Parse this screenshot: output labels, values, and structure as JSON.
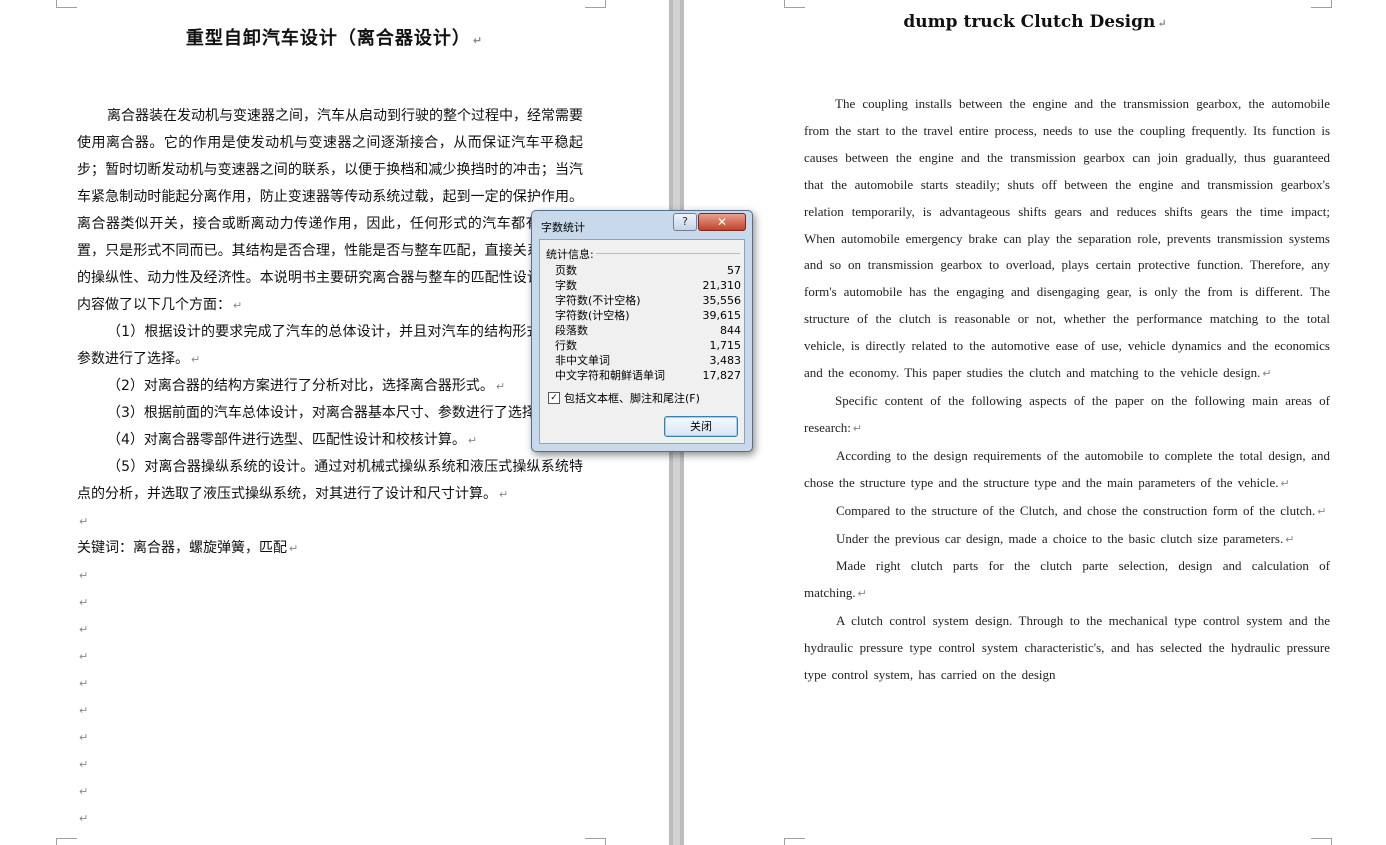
{
  "left_page": {
    "title": "重型自卸汽车设计（离合器设计）",
    "paragraphs": [
      "离合器装在发动机与变速器之间，汽车从启动到行驶的整个过程中，经常需要使用离合器。它的作用是使发动机与变速器之间逐渐接合，从而保证汽车平稳起步；暂时切断发动机与变速器之间的联系，以便于换档和减少换挡时的冲击；当汽车紧急制动时能起分离作用，防止变速器等传动系统过载，起到一定的保护作用。离合器类似开关，接合或断离动力传递作用，因此，任何形式的汽车都有离合装置，只是形式不同而已。其结构是否合理，性能是否与整车匹配，直接关系到汽车的操纵性、动力性及经济性。本说明书主要研究离合器与整车的匹配性设计，具体内容做了以下几个方面：",
      "（1）根据设计的要求完成了汽车的总体设计，并且对汽车的结构形式和主要参数进行了选择。",
      "（2）对离合器的结构方案进行了分析对比，选择离合器形式。",
      "（3）根据前面的汽车总体设计，对离合器基本尺寸、参数进行了选择。",
      "（4）对离合器零部件进行选型、匹配性设计和校核计算。",
      "（5）对离合器操纵系统的设计。通过对机械式操纵系统和液压式操纵系统特点的分析，并选取了液压式操纵系统，对其进行了设计和尺寸计算。"
    ],
    "keywords": "关键词：离合器，螺旋弹簧，匹配",
    "paragraph_mark": "↵"
  },
  "right_page": {
    "title": "dump truck Clutch Design",
    "paragraphs": [
      "The coupling installs between the engine and the transmission gearbox, the automobile from the start to the travel entire process, needs to use the coupling frequently. Its function is causes between the engine and the transmission gearbox can join gradually, thus guaranteed that the automobile starts steadily; shuts off between the engine and transmission gearbox's relation temporarily, is advantageous shifts gears and reduces shifts gears the time impact; When automobile emergency brake can play the separation role, prevents transmission systems and so on transmission gearbox to overload, plays certain protective function. Therefore, any form's automobile has the engaging and disengaging gear, is only the from is different. The structure of the clutch is reasonable or not, whether the performance matching to the total vehicle, is directly related to the automotive ease of use, vehicle dynamics and the economics and the economy. This paper studies the clutch and matching to the vehicle design.",
      "Specific content of the following aspects of the paper on the following main areas of research:",
      "According to the design requirements of the automobile to complete the total design, and chose the structure type and the structure type and the main parameters of the vehicle.",
      "Compared to the structure of the Clutch, and chose the construction form of the clutch.",
      "Under the previous car design, made a choice to the basic clutch size parameters.",
      "Made right clutch parts for the clutch parte selection, design and calculation of matching.",
      "A clutch control system design. Through to the mechanical type control system and the hydraulic pressure type control system characteristic's, and has selected the hydraulic pressure type control system, has carried on the design"
    ]
  },
  "dialog": {
    "title": "字数统计",
    "help_label": "?",
    "close_x_label": "✕",
    "section_label": "统计信息:",
    "stats": [
      {
        "label": "页数",
        "value": "57"
      },
      {
        "label": "字数",
        "value": "21,310"
      },
      {
        "label": "字符数(不计空格)",
        "value": "35,556"
      },
      {
        "label": "字符数(计空格)",
        "value": "39,615"
      },
      {
        "label": "段落数",
        "value": "844"
      },
      {
        "label": "行数",
        "value": "1,715"
      },
      {
        "label": "非中文单词",
        "value": "3,483"
      },
      {
        "label": "中文字符和朝鲜语单词",
        "value": "17,827"
      }
    ],
    "checkbox_label": "包括文本框、脚注和尾注(F)",
    "checkbox_checked": "✓",
    "close_button_label": "关闭"
  }
}
